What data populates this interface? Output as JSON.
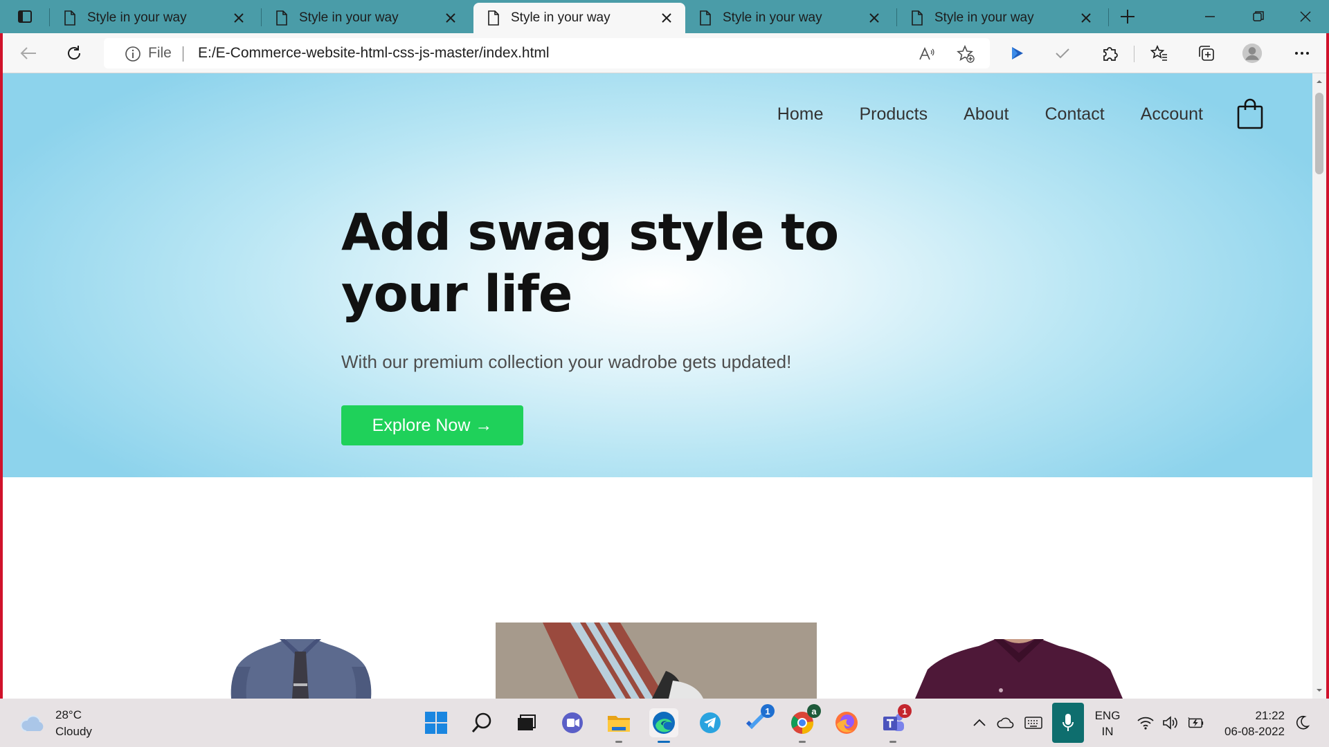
{
  "browser": {
    "tabs": [
      {
        "title": "Style in your way",
        "active": false
      },
      {
        "title": "Style in your way",
        "active": false
      },
      {
        "title": "Style in your way",
        "active": true
      },
      {
        "title": "Style in your way",
        "active": false
      },
      {
        "title": "Style in your way",
        "active": false
      }
    ],
    "address": {
      "scheme": "File",
      "url": "E:/E-Commerce-website-html-css-js-master/index.html"
    }
  },
  "site": {
    "nav": [
      "Home",
      "Products",
      "About",
      "Contact",
      "Account"
    ],
    "hero": {
      "title": "Add swag style to your life",
      "subtitle": "With our premium collection your wadrobe gets updated!",
      "cta": "Explore Now →"
    },
    "products": [
      {
        "description": "man in blue-grey dress shirt with dark tie"
      },
      {
        "description": "leg in rust track pants with white stripes"
      },
      {
        "description": "man in purple dress shirt"
      }
    ]
  },
  "taskbar": {
    "weather": {
      "temp": "28°C",
      "condition": "Cloudy"
    },
    "apps": [
      {
        "name": "windows-start-icon"
      },
      {
        "name": "search-icon"
      },
      {
        "name": "task-view-icon"
      },
      {
        "name": "meet-chat-icon"
      },
      {
        "name": "file-explorer-icon",
        "running": true
      },
      {
        "name": "edge-browser-icon",
        "running": true,
        "active": true
      },
      {
        "name": "telegram-icon"
      },
      {
        "name": "todo-icon",
        "badge": "1"
      },
      {
        "name": "chrome-icon",
        "running": true
      },
      {
        "name": "firefox-icon"
      },
      {
        "name": "teams-icon",
        "badge": "1",
        "running": true
      }
    ],
    "language": {
      "line1": "ENG",
      "line2": "IN"
    },
    "clock": {
      "time": "21:22",
      "date": "06-08-2022"
    }
  },
  "colors": {
    "tab_strip": "#4a9ca8",
    "frame": "#d0122b",
    "cta": "#1fd15a",
    "hero_edge": "#8dd3ec"
  }
}
